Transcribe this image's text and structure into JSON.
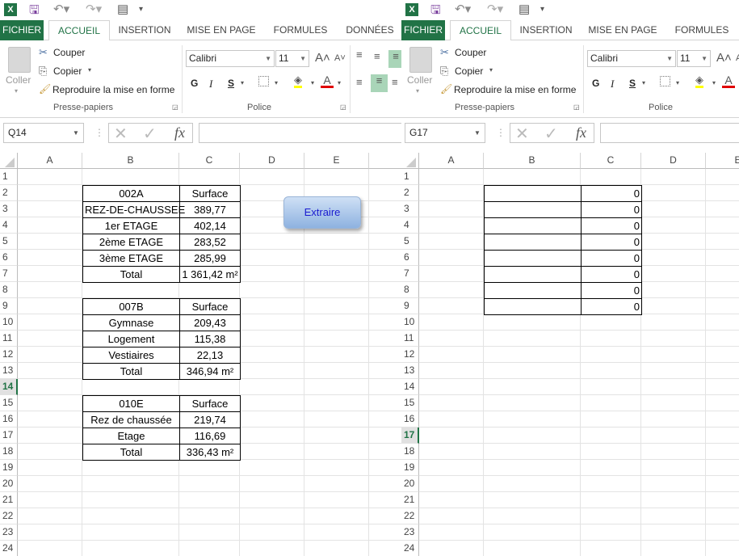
{
  "windows": [
    {
      "id": "left",
      "tabs": [
        "FICHIER",
        "ACCUEIL",
        "INSERTION",
        "MISE EN PAGE",
        "FORMULES",
        "DONNÉES"
      ],
      "active_tab": 1,
      "clipboard": {
        "paste": "Coller",
        "cut": "Couper",
        "copy": "Copier",
        "format_painter": "Reproduire la mise en forme",
        "group": "Presse-papiers"
      },
      "font": {
        "name": "Calibri",
        "size": "11",
        "bold": "G",
        "italic": "I",
        "underline": "S",
        "group": "Police"
      },
      "name_box": "Q14",
      "formula": "",
      "columns": [
        "A",
        "B",
        "C",
        "D",
        "E"
      ],
      "rows": 24,
      "selected_row": 14,
      "button": "Extraire",
      "cells": {
        "B2": "002A",
        "C2": "Surface",
        "B3": "REZ-DE-CHAUSSEE",
        "C3": "389,77",
        "B4": "1er ETAGE",
        "C4": "402,14",
        "B5": "2ème ETAGE",
        "C5": "283,52",
        "B6": "3ème ETAGE",
        "C6": "285,99",
        "B7": "Total",
        "C7": "1 361,42 m²",
        "B9": "007B",
        "C9": "Surface",
        "B10": "Gymnase",
        "C10": "209,43",
        "B11": "Logement",
        "C11": "115,38",
        "B12": "Vestiaires",
        "C12": "22,13",
        "B13": "Total",
        "C13": "346,94 m²",
        "B15": "010E",
        "C15": "Surface",
        "B16": "Rez de chaussée",
        "C16": "219,74",
        "B17": "Etage",
        "C17": "116,69",
        "B18": "Total",
        "C18": "336,43 m²"
      }
    },
    {
      "id": "right",
      "tabs": [
        "FICHIER",
        "ACCUEIL",
        "INSERTION",
        "MISE EN PAGE",
        "FORMULES"
      ],
      "active_tab": 1,
      "clipboard": {
        "paste": "Coller",
        "cut": "Couper",
        "copy": "Copier",
        "format_painter": "Reproduire la mise en forme",
        "group": "Presse-papiers"
      },
      "font": {
        "name": "Calibri",
        "size": "11",
        "bold": "G",
        "italic": "I",
        "underline": "S",
        "group": "Police"
      },
      "name_box": "G17",
      "formula": "",
      "columns": [
        "A",
        "B",
        "C",
        "D",
        "E"
      ],
      "rows": 24,
      "selected_row": 17,
      "cells": {
        "C2": "0",
        "C3": "0",
        "C4": "0",
        "C5": "0",
        "C6": "0",
        "C7": "0",
        "C8": "0",
        "C9": "0"
      }
    }
  ],
  "colors": {
    "excel_green": "#217346",
    "button_text": "#1a1ad0"
  }
}
